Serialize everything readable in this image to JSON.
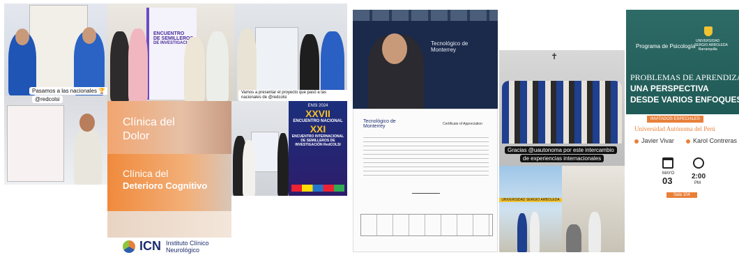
{
  "panel1": {
    "caption": "Pasamos a las nacionales 🏆",
    "tag": "@redcolsi"
  },
  "panel2": {
    "banner_line1": "ENCUENTRO",
    "banner_line2": "DE SEMILLEROS",
    "banner_line3": "DE INVESTIGACIÓN"
  },
  "panel3": {
    "caption": "Vamos a presentar el proyecto que pasó a las nacionales de @redcolsi"
  },
  "panel4": {
    "clinic1_line1": "Clínica del",
    "clinic1_line2": "Dolor",
    "clinic2_line1": "Clínica del",
    "clinic2_line2": "Deterioro Cognitivo",
    "logo_short": "ICN",
    "logo_line1": "Instituto Clínico",
    "logo_line2": "Neurológico"
  },
  "panel5": {
    "tag": "ENSI 2024",
    "num1": "XXVII",
    "line1": "ENCUENTRO NACIONAL",
    "num2": "XXI",
    "line2": "ENCUENTRO INTERNACIONAL",
    "line3": "DE SEMILLEROS DE",
    "line4": "INVESTIGACIÓN RedCOLSI"
  },
  "panel6": {
    "brand": "Tecnológico de Monterrey"
  },
  "panel7": {
    "brand": "Tecnológico de Monterrey",
    "title": "Certificate of Appreciation"
  },
  "panel8": {
    "caption_line1": "Gracias @uautonoma por este intercambio",
    "caption_line2": "de experiencias internacionales",
    "sign": "UNIVERSIDAD SERGIO ARBOLEDA"
  },
  "panel9": {
    "program": "Programa de Psicología",
    "uni_line1": "UNIVERSIDAD",
    "uni_line2": "SERGIO ARBOLEDA",
    "uni_line3": "Barranquilla",
    "title1": "PROBLEMAS DE APRENDIZAJE",
    "title2": "UNA PERSPECTIVA",
    "title3": "DESDE VARIOS ENFOQUES",
    "guests_label": "INVITADOS ESPECIALES",
    "guest_uni": "Universidad Autónoma del Perú",
    "guest1": "Javier Vivar",
    "guest2": "Karol Contreras",
    "month": "MAYO",
    "day": "03",
    "time": "2:00",
    "ampm": "PM",
    "room": "Sala 104"
  },
  "colors": {
    "teal": "#1f6f6a",
    "orange": "#e8803a",
    "navy": "#1c2d6e"
  }
}
